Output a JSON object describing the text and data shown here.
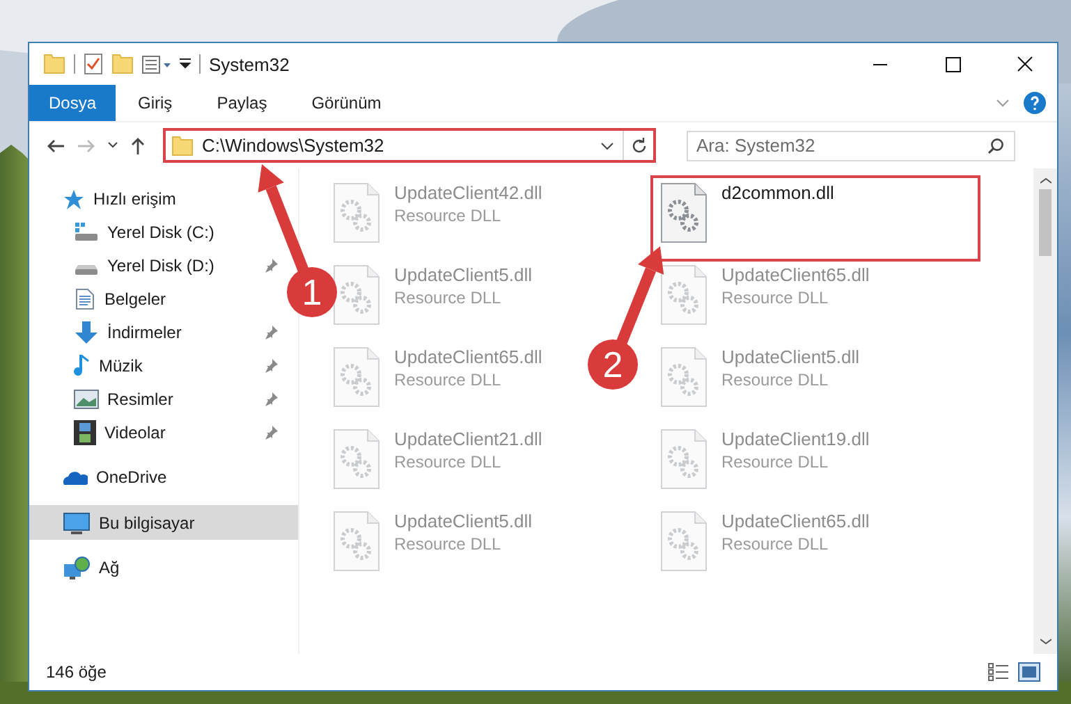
{
  "window": {
    "title": "System32"
  },
  "ribbon": {
    "tabs": [
      {
        "label": "Dosya",
        "kind": "file"
      },
      {
        "label": "Giriş",
        "kind": "tab"
      },
      {
        "label": "Paylaş",
        "kind": "tab"
      },
      {
        "label": "Görünüm",
        "kind": "tab"
      }
    ]
  },
  "address": {
    "path": "C:\\Windows\\System32",
    "highlighted": true
  },
  "search": {
    "placeholder": "Ara: System32"
  },
  "sidebar": {
    "items": [
      {
        "label": "Hızlı erişim",
        "kind": "star",
        "selected": false,
        "children": [
          {
            "label": "Yerel Disk (C:)",
            "kind": "drive-c"
          },
          {
            "label": "Yerel Disk (D:)",
            "kind": "drive",
            "pinned": true
          },
          {
            "label": "Belgeler",
            "kind": "documents"
          },
          {
            "label": "İndirmeler",
            "kind": "downloads",
            "pinned": true
          },
          {
            "label": "Müzik",
            "kind": "music",
            "pinned": true
          },
          {
            "label": "Resimler",
            "kind": "pictures",
            "pinned": true
          },
          {
            "label": "Videolar",
            "kind": "videos",
            "pinned": true
          }
        ]
      },
      {
        "label": "OneDrive",
        "kind": "cloud",
        "selected": false
      },
      {
        "label": "Bu bilgisayar",
        "kind": "computer",
        "selected": true
      },
      {
        "label": "Ağ",
        "kind": "network",
        "selected": false
      }
    ]
  },
  "files": [
    {
      "name": "UpdateClient42.dll",
      "type": "Resource DLL",
      "faded": true,
      "highlighted": false
    },
    {
      "name": "d2common.dll",
      "faded": false,
      "highlighted": true
    },
    {
      "name": "UpdateClient5.dll",
      "type": "Resource DLL",
      "faded": true,
      "highlighted": false
    },
    {
      "name": "UpdateClient65.dll",
      "type": "Resource DLL",
      "faded": true,
      "highlighted": false
    },
    {
      "name": "UpdateClient65.dll",
      "type": "Resource DLL",
      "faded": true,
      "highlighted": false
    },
    {
      "name": "UpdateClient5.dll",
      "type": "Resource DLL",
      "faded": true,
      "highlighted": false
    },
    {
      "name": "UpdateClient21.dll",
      "type": "Resource DLL",
      "faded": true,
      "highlighted": false
    },
    {
      "name": "UpdateClient19.dll",
      "type": "Resource DLL",
      "faded": true,
      "highlighted": false
    },
    {
      "name": "UpdateClient5.dll",
      "type": "Resource DLL",
      "faded": true,
      "highlighted": false
    },
    {
      "name": "UpdateClient65.dll",
      "type": "Resource DLL",
      "faded": true,
      "highlighted": false
    }
  ],
  "status_bar": {
    "count": "146 öğe"
  },
  "annotations": [
    {
      "label": "1"
    },
    {
      "label": "2"
    }
  ]
}
